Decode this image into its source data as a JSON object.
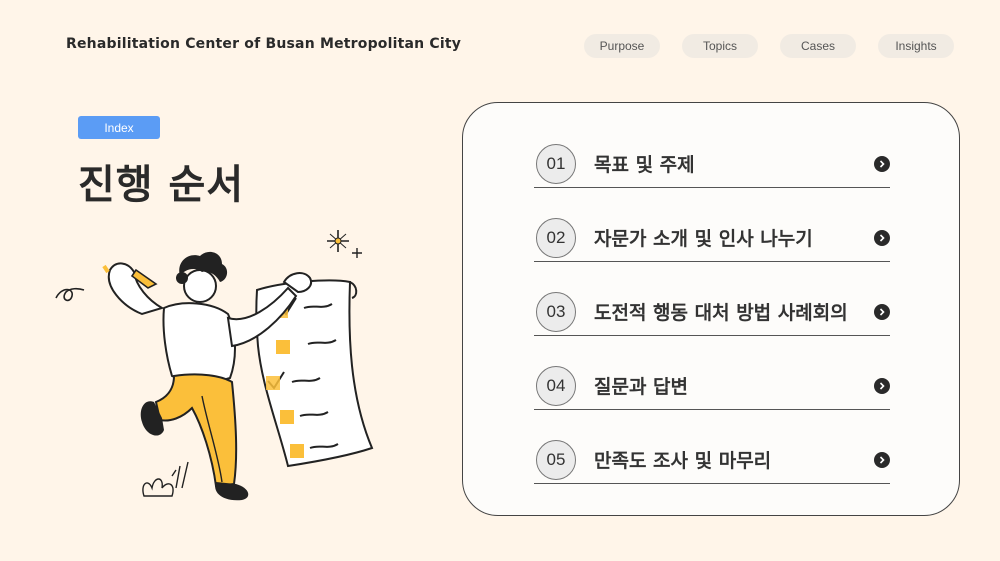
{
  "header": {
    "org_title": "Rehabilitation Center of Busan Metropolitan City",
    "nav": [
      "Purpose",
      "Topics",
      "Cases",
      "Insights"
    ]
  },
  "section": {
    "badge": "Index",
    "title": "진행 순서"
  },
  "agenda": [
    {
      "num": "01",
      "label": "목표 및 주제"
    },
    {
      "num": "02",
      "label": "자문가 소개 및 인사 나누기"
    },
    {
      "num": "03",
      "label": "도전적 행동 대처 방법 사례회의"
    },
    {
      "num": "04",
      "label": "질문과 답변"
    },
    {
      "num": "05",
      "label": "만족도 조사 및 마무리"
    }
  ],
  "colors": {
    "background": "#fff5e9",
    "accent_blue": "#5b9cf5",
    "illustration_yellow": "#fbbf3a",
    "illustration_dark": "#222222"
  },
  "icons": {
    "agenda_arrow": "chevron-right-circle-icon",
    "illustration": "person-with-checklist"
  }
}
